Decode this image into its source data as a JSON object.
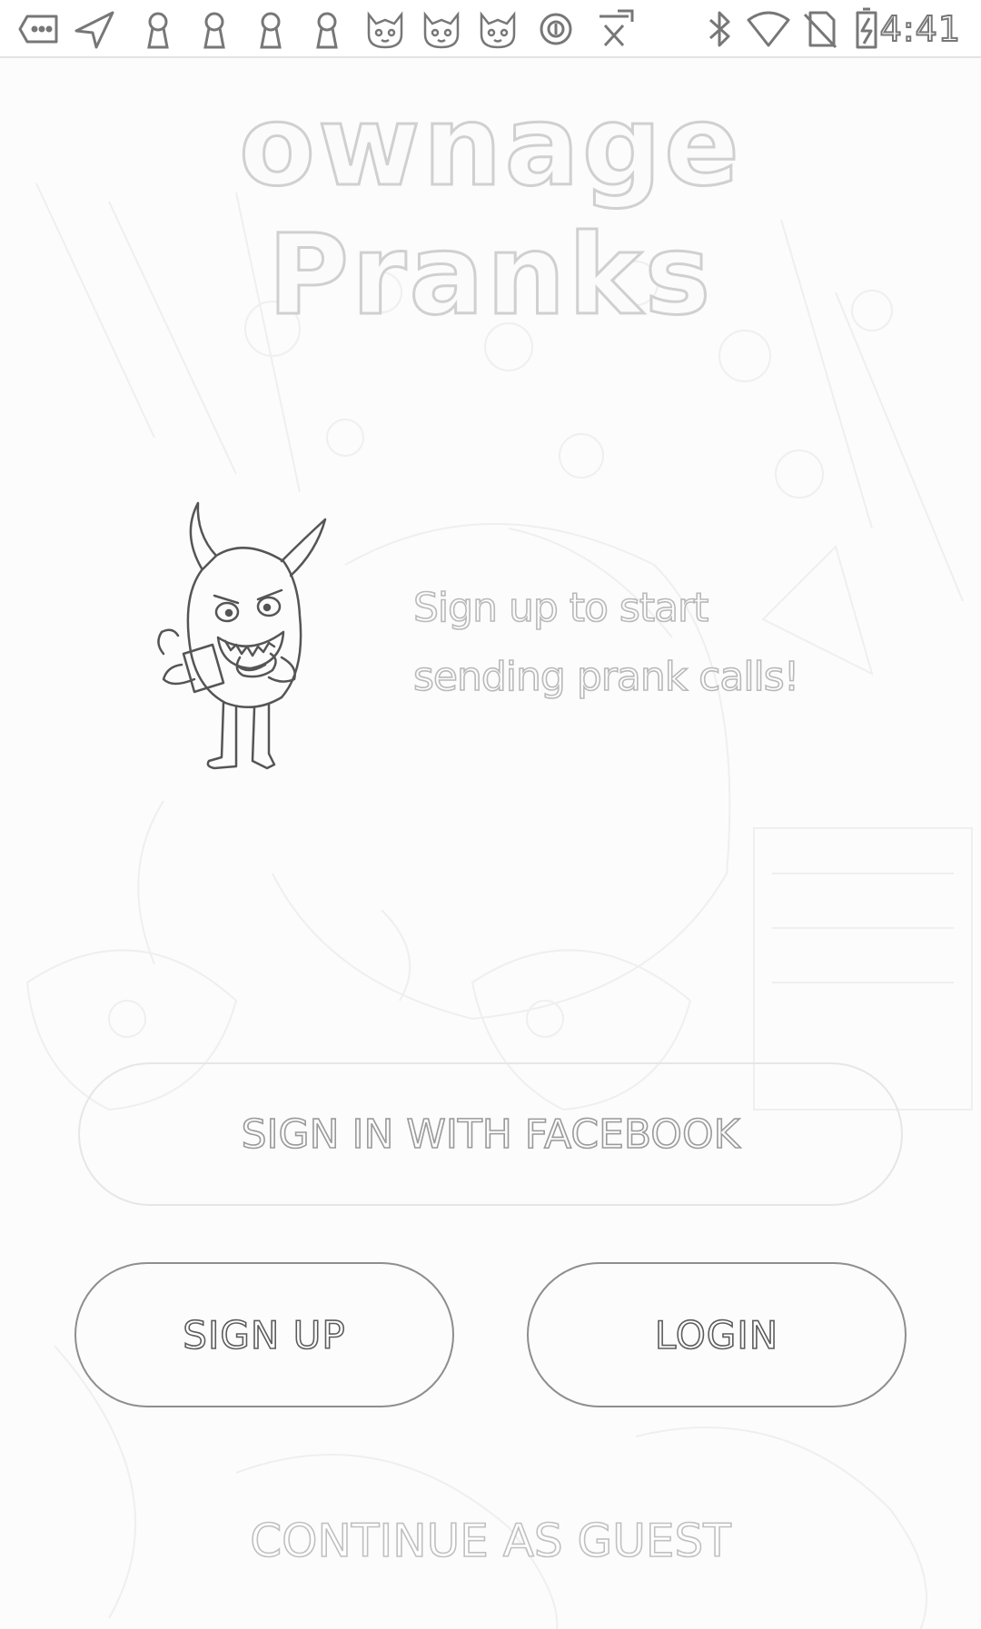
{
  "status_bar": {
    "time": "4:41",
    "left_icons": [
      "more-icon",
      "send-icon",
      "keyhole-icon",
      "keyhole-icon",
      "keyhole-icon",
      "keyhole-icon",
      "cat-icon",
      "cat-icon",
      "cat-icon",
      "circle-icon",
      "badge-icon"
    ],
    "right_icons": [
      "bluetooth-icon",
      "wifi-icon",
      "no-sim-icon",
      "battery-charging-icon"
    ]
  },
  "app": {
    "title": "ownage Pranks",
    "tagline_line1": "Sign up to start",
    "tagline_line2": "sending prank calls!"
  },
  "buttons": {
    "facebook_label": "SIGN IN WITH FACEBOOK",
    "signup_label": "SIGN UP",
    "login_label": "LOGIN",
    "guest_label": "CONTINUE AS GUEST"
  },
  "illustration": {
    "icon": "devil-monster-icon"
  },
  "colors": {
    "background": "#fcfcfc",
    "outline_dark": "#8e8e8e",
    "outline_light": "#e6e6e6"
  }
}
